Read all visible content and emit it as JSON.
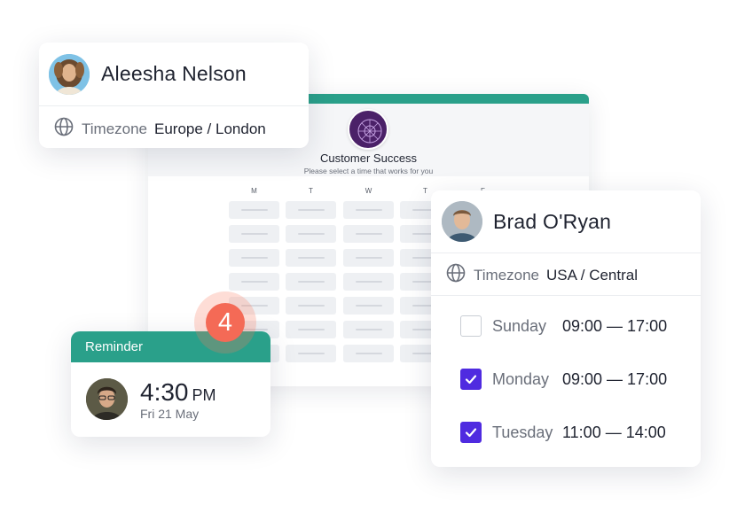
{
  "calendar": {
    "title": "Customer Success",
    "subtitle": "Please select a time that works for you",
    "day_labels": [
      "M",
      "T",
      "W",
      "T",
      "F"
    ],
    "accent_color": "#2aa08a",
    "logo_color": "#4b2168"
  },
  "contact_one": {
    "name": "Aleesha Nelson",
    "timezone_label": "Timezone",
    "timezone_value": "Europe / London",
    "icon": "globe-icon"
  },
  "contact_two": {
    "name": "Brad O'Ryan",
    "timezone_label": "Timezone",
    "timezone_value": "USA / Central",
    "icon": "globe-icon",
    "schedule": [
      {
        "day": "Sunday",
        "hours": "09:00 — 17:00",
        "checked": false
      },
      {
        "day": "Monday",
        "hours": "09:00 — 17:00",
        "checked": true
      },
      {
        "day": "Tuesday",
        "hours": "11:00 — 14:00",
        "checked": true
      }
    ],
    "checkbox_color": "#4f2be0"
  },
  "reminder": {
    "header": "Reminder",
    "time": "4:30",
    "ampm": "PM",
    "date": "Fri 21 May",
    "header_color": "#2aa08a"
  },
  "badge": {
    "count": "4",
    "color": "#f46a56"
  }
}
